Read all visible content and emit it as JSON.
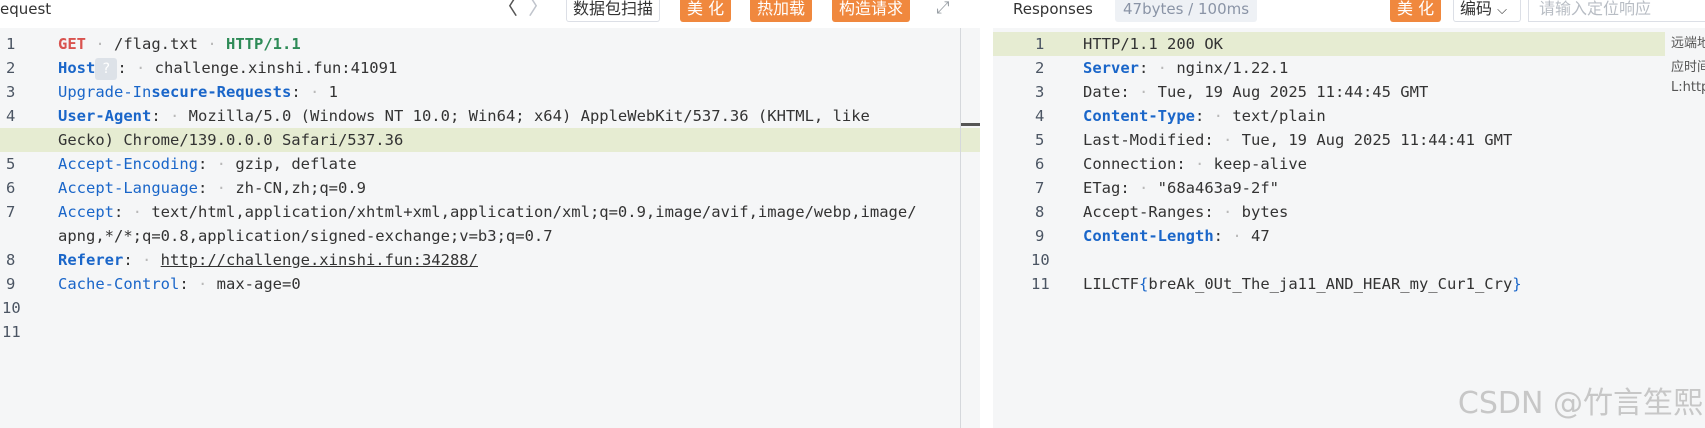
{
  "request": {
    "title": "equest",
    "nav_prev": "〈",
    "nav_next": "〉",
    "buttons": {
      "scan": "数据包扫描",
      "beautify": "美 化",
      "hot_load": "热加载",
      "build": "构造请求"
    },
    "expand_icon": "⤢",
    "host_help": "?",
    "lines": {
      "l1": {
        "method": "GET",
        "path": "/flag.txt",
        "proto": "HTTP/1.1"
      },
      "l2": {
        "key": "Host",
        "value": "challenge.xinshi.fun:41091"
      },
      "l3": {
        "key_a": "Upgrade-In",
        "key_b": "secure-Requests",
        "value": "1"
      },
      "l4": {
        "key": "User-Agent",
        "value": "Mozilla/5.0 (Windows NT 10.0; Win64; x64) AppleWebKit/537.36 (KHTML, like",
        "cont": "Gecko) Chrome/139.0.0.0 Safari/537.36"
      },
      "l5": {
        "key": "Accept-Encoding",
        "value": "gzip, deflate"
      },
      "l6": {
        "key": "Accept-Language",
        "value": "zh-CN,zh;q=0.9"
      },
      "l7": {
        "key": "Accept",
        "value": "text/html,application/xhtml+xml,application/xml;q=0.9,image/avif,image/webp,image/",
        "cont": "apng,*/*;q=0.8,application/signed-exchange;v=b3;q=0.7"
      },
      "l8": {
        "key": "Referer",
        "value": "http://challenge.xinshi.fun:34288/"
      },
      "l9": {
        "key": "Cache-Control",
        "value": "max-age=0"
      }
    },
    "line_numbers": [
      "1",
      "2",
      "3",
      "4",
      "5",
      "6",
      "7",
      "8",
      "9",
      "10",
      "11"
    ]
  },
  "response": {
    "title": "Responses",
    "size_badge": "47bytes / 100ms",
    "buttons": {
      "beautify": "美 化",
      "encoding": "编码",
      "encoding_caret": "⌵"
    },
    "search_placeholder": "请输入定位响应",
    "side_notes": [
      "远端地",
      "应时间",
      "L:http"
    ],
    "line_numbers": [
      "1",
      "2",
      "3",
      "4",
      "5",
      "6",
      "7",
      "8",
      "9",
      "10",
      "11"
    ],
    "lines": {
      "l1": "HTTP/1.1 200 OK",
      "l2": {
        "key": "Server",
        "value": "nginx/1.22.1"
      },
      "l3": {
        "key": "Date",
        "value": "Tue, 19 Aug 2025 11:44:45 GMT"
      },
      "l4": {
        "key": "Content-Type",
        "value": "text/plain"
      },
      "l5": {
        "key": "Last-Modified",
        "value": "Tue, 19 Aug 2025 11:44:41 GMT"
      },
      "l6": {
        "key": "Connection",
        "value": "keep-alive"
      },
      "l7": {
        "key": "ETag",
        "value": "\"68a463a9-2f\""
      },
      "l8": {
        "key": "Accept-Ranges",
        "value": "bytes"
      },
      "l9": {
        "key": "Content-Length",
        "value": "47"
      },
      "l11": {
        "prefix": "LILCTF",
        "open": "{",
        "body": "breAk_0Ut_The_ja11_AND_HEAR_my_Cur1_Cry",
        "close": "}"
      }
    }
  },
  "watermark": "CSDN @竹言笙熙"
}
